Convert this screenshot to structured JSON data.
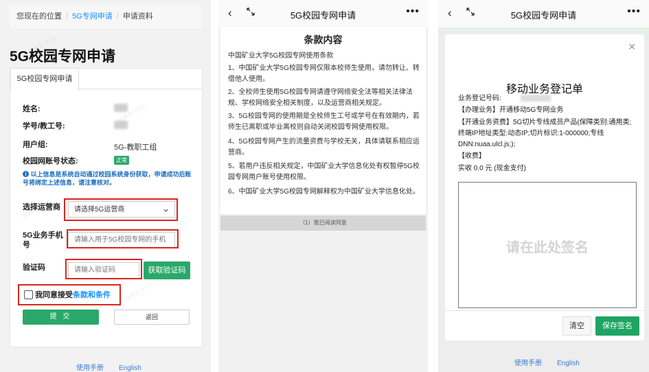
{
  "form_page": {
    "breadcrumb": [
      "您现在的位置",
      "5G专网申请",
      "申请资料"
    ],
    "title": "5G校园专网申请",
    "tab_label": "5G校园专网申请",
    "info": {
      "name_label": "姓名:",
      "id_label": "学号/教工号:",
      "group_label": "用户组:",
      "group_value": "5G-教职工组",
      "status_label": "校园网账号状态:",
      "status_badge": "正常",
      "notice": "以上信息是系统自动通过校园系统身份获取，申请成功后账号将绑定上述信息，请注意核对。"
    },
    "fields": {
      "operator_label": "选择运营商",
      "operator_placeholder": "请选择5G运营商",
      "phone_label": "5G业务手机号",
      "phone_placeholder": "请输入用于5G校园专网的手机",
      "code_label": "验证码",
      "code_placeholder": "请输入验证码",
      "get_code_button": "获取验证码"
    },
    "agree_prefix": "我同意接受",
    "agree_link": "条款和条件",
    "submit_button": "提 交",
    "back_button": "返回",
    "footer": {
      "manual": "使用手册",
      "english": "English"
    },
    "watermark": "信息化 9724"
  },
  "terms_page": {
    "header_title": "5G校园专网申请",
    "heading": "条款内容",
    "subheading": "中国矿业大学5G校园专网使用条款",
    "items": [
      "1、中国矿业大学5G校园专网仅限本校师生使用，请勿转让、转借他人使用。",
      "2、全校师生使用5G校园专网请遵守网络安全法等相关法律法规、学校网络安全相关制度，以及运营商相关规定。",
      "3、5G校园专网的使用期是全校师生工号或学号在有效期内，若师生已离职或毕业离校则自动关闭校园专网使用权限。",
      "4、5G校园专网产生的流量资费与学校无关，具体请联系相应运营商。",
      "5、若用户违反相关规定，中国矿业大学信息化处有权暂停5G校园专网用户账号使用权限。",
      "6、中国矿业大学5G校园专网解释权为中国矿业大学信息化处。"
    ],
    "read_bar": "（1）我已阅读同意"
  },
  "register_page": {
    "header_title": "5G校园专网申请",
    "modal_title": "移动业务登记单",
    "reg_no_label": "业务登记号码:",
    "business": "【办理业务】开通移动5G专网业务",
    "fee_item": "【开通业务资费】5G切片专线成员产品(保障类别:通用类;终端IP地址类型:动态IP;切片标识:1-000000;专线DNN:nuaa.ulcl.js;);",
    "fee_label": "【收费】",
    "fee_value": "实收 0.0 元 (现金支付)",
    "sign_placeholder": "请在此处签名",
    "clear_button": "清空",
    "save_button": "保存签名",
    "footer": {
      "manual": "使用手册",
      "english": "English"
    }
  },
  "icons": {
    "back": "chevron-left-icon",
    "expand": "expand-arrows-icon",
    "more": "more-dots-icon",
    "close": "close-icon",
    "info": "info-icon",
    "dropdown": "chevron-down-icon"
  },
  "colors": {
    "accent_green": "#2aa86b",
    "link_blue": "#1890ff",
    "highlight_red": "#d9261c"
  }
}
